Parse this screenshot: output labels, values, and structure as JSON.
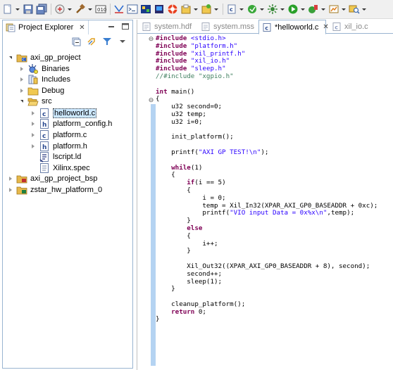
{
  "toolbar": {
    "buttons": [
      "new-icon",
      "save-icon",
      "save-all-icon",
      "program-fpga-icon",
      "build-icon",
      "sdk-icon",
      "xmd-console-icon",
      "terminal-icon",
      "board-icon",
      "hardware-icon",
      "launch-icon",
      "launch-config-icon",
      "new-project-icon",
      "new-source-icon",
      "debug-icon",
      "external-tool-icon",
      "run-icon",
      "run-config-icon",
      "coverage-icon",
      "search-icon"
    ]
  },
  "explorer": {
    "title": "Project Explorer",
    "tree": [
      {
        "label": "axi_gp_project",
        "icon": "project-icon",
        "depth": 0,
        "state": "expanded"
      },
      {
        "label": "Binaries",
        "icon": "binaries-icon",
        "depth": 1,
        "state": "collapsed"
      },
      {
        "label": "Includes",
        "icon": "includes-icon",
        "depth": 1,
        "state": "collapsed"
      },
      {
        "label": "Debug",
        "icon": "folder-icon",
        "depth": 1,
        "state": "collapsed"
      },
      {
        "label": "src",
        "icon": "folder-open-icon",
        "depth": 1,
        "state": "expanded"
      },
      {
        "label": "helloworld.c",
        "icon": "c-file-icon",
        "depth": 2,
        "state": "collapsed",
        "selected": true
      },
      {
        "label": "platform_config.h",
        "icon": "h-file-icon",
        "depth": 2,
        "state": "collapsed"
      },
      {
        "label": "platform.c",
        "icon": "c-file-icon",
        "depth": 2,
        "state": "collapsed"
      },
      {
        "label": "platform.h",
        "icon": "h-file-icon",
        "depth": 2,
        "state": "collapsed"
      },
      {
        "label": "lscript.ld",
        "icon": "linker-script-icon",
        "depth": 2,
        "state": "none"
      },
      {
        "label": "Xilinx.spec",
        "icon": "spec-file-icon",
        "depth": 2,
        "state": "none"
      },
      {
        "label": "axi_gp_project_bsp",
        "icon": "bsp-project-icon",
        "depth": 0,
        "state": "collapsed"
      },
      {
        "label": "zstar_hw_platform_0",
        "icon": "hw-platform-icon",
        "depth": 0,
        "state": "collapsed"
      }
    ]
  },
  "editor": {
    "tabs": [
      {
        "label": "system.hdf",
        "active": false
      },
      {
        "label": "system.mss",
        "active": false
      },
      {
        "label": "*helloworld.c",
        "active": true
      },
      {
        "label": "xil_io.c",
        "active": false
      }
    ],
    "code_lines": [
      "#include <stdio.h>",
      "#include \"platform.h\"",
      "#include \"xil_printf.h\"",
      "#include \"xil_io.h\"",
      "#include \"sleep.h\"",
      "//#include \"xgpio.h\"",
      "",
      "int main()",
      "{",
      "    u32 second=0;",
      "    u32 temp;",
      "    u32 i=0;",
      "",
      "    init_platform();",
      "",
      "    printf(\"AXI GP TEST!\\n\");",
      "",
      "    while(1)",
      "    {",
      "        if(i == 5)",
      "        {",
      "            i = 0;",
      "            temp = Xil_In32(XPAR_AXI_GP0_BASEADDR + 0xc);",
      "            printf(\"VIO input Data = 0x%x\\n\",temp);",
      "        }",
      "        else",
      "        {",
      "            i++;",
      "        }",
      "",
      "        Xil_Out32((XPAR_AXI_GP0_BASEADDR + 8), second);",
      "        second++;",
      "        sleep(1);",
      "    }",
      "",
      "    cleanup_platform();",
      "    return 0;",
      "}"
    ]
  }
}
